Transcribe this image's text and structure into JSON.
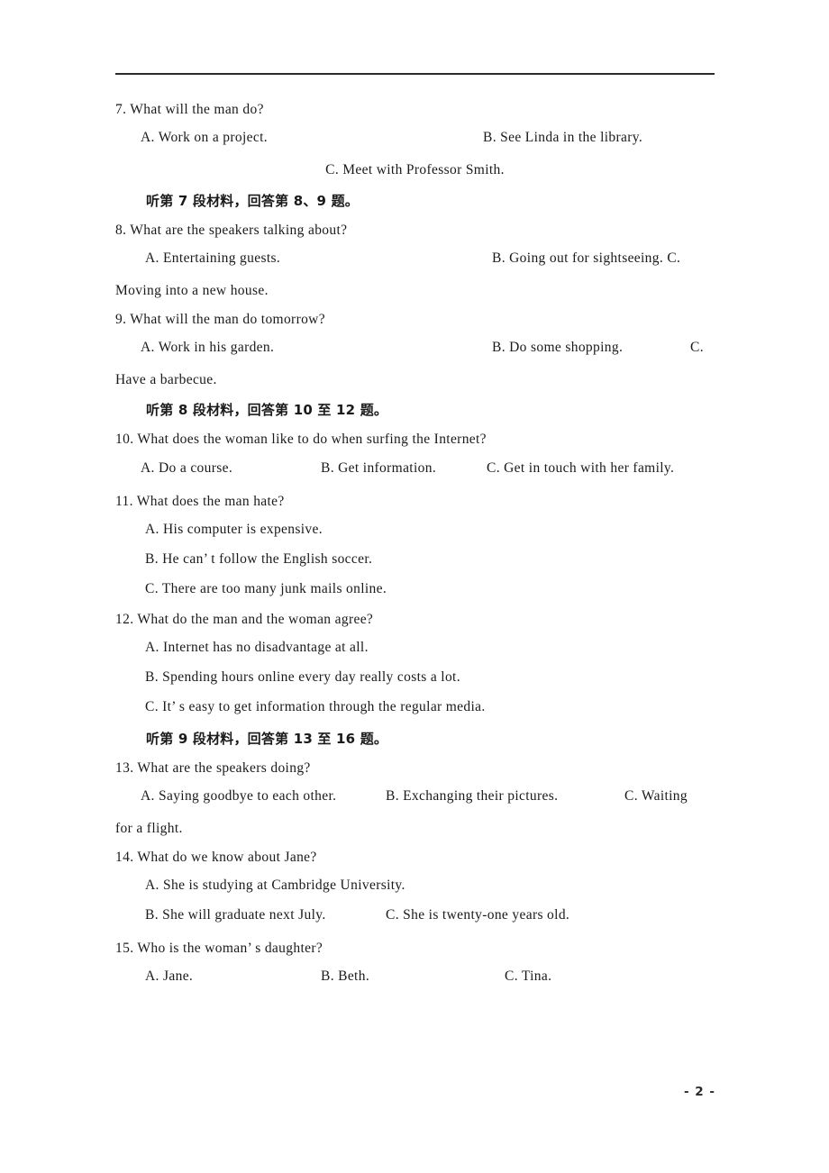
{
  "document": {
    "page_label": "- 2 -",
    "header_rule": true
  },
  "questions": [
    {
      "id": "q7",
      "number": "7.",
      "stem": "7. What will the man do?",
      "options": [
        {
          "letter": "A.",
          "text": "A. Work on a project."
        },
        {
          "letter": "B.",
          "text": "B. See Linda in the library."
        },
        {
          "letter": "C.",
          "text": "C. Meet with Professor Smith."
        }
      ]
    },
    {
      "id": "q8",
      "number": "8.",
      "stem": "8. What are the speakers talking about?",
      "options": [
        {
          "letter": "A.",
          "text": "A. Entertaining guests."
        },
        {
          "letter": "B.",
          "text": "B. Going out for sightseeing. C."
        },
        {
          "letter": "C.",
          "text": "Moving into a new house."
        }
      ]
    },
    {
      "id": "q9",
      "number": "9.",
      "stem": "9.  What will the man do tomorrow?",
      "options": [
        {
          "letter": "A.",
          "text": "A. Work in his garden."
        },
        {
          "letter": "B.",
          "text": "B. Do some shopping."
        },
        {
          "letter": "C.",
          "text": "C."
        },
        {
          "letter": "C-cont",
          "text": "Have a barbecue."
        }
      ]
    },
    {
      "id": "q10",
      "number": "10.",
      "stem": "10. What does the woman like to do when surfing the Internet?",
      "options": [
        {
          "letter": "A.",
          "text": "A. Do a course."
        },
        {
          "letter": "B.",
          "text": "B. Get information."
        },
        {
          "letter": "C.",
          "text": "C. Get in touch with her family."
        }
      ]
    },
    {
      "id": "q11",
      "number": "11.",
      "stem": "11. What does the man hate?",
      "options": [
        {
          "letter": "A.",
          "text": "A. His computer is expensive."
        },
        {
          "letter": "B.",
          "text": "B. He can’ t follow the English soccer."
        },
        {
          "letter": "C.",
          "text": "C. There are too many junk mails online."
        }
      ]
    },
    {
      "id": "q12",
      "number": "12.",
      "stem": "12. What do the man and the woman agree?",
      "options": [
        {
          "letter": "A.",
          "text": "A. Internet has no disadvantage at all."
        },
        {
          "letter": "B.",
          "text": "B. Spending hours online every day really costs a lot."
        },
        {
          "letter": "C.",
          "text": "C. It’ s easy to get information through the regular media."
        }
      ]
    },
    {
      "id": "q13",
      "number": "13.",
      "stem": "13. What are the speakers doing?",
      "options": [
        {
          "letter": "A.",
          "text": "A. Saying goodbye to each other."
        },
        {
          "letter": "B.",
          "text": "B. Exchanging their pictures."
        },
        {
          "letter": "C.",
          "text": "C. Waiting"
        },
        {
          "letter": "C-cont",
          "text": "for a flight."
        }
      ]
    },
    {
      "id": "q14",
      "number": "14.",
      "stem": "14. What do we know about Jane?",
      "options": [
        {
          "letter": "A.",
          "text": "A. She is studying at Cambridge University."
        },
        {
          "letter": "B.",
          "text": "B. She will graduate next July."
        },
        {
          "letter": "C.",
          "text": "C. She is twenty-one years old."
        }
      ]
    },
    {
      "id": "q15",
      "number": "15.",
      "stem": "15. Who is the woman’ s daughter?",
      "options": [
        {
          "letter": "A.",
          "text": "A. Jane."
        },
        {
          "letter": "B.",
          "text": "B. Beth."
        },
        {
          "letter": "C.",
          "text": "C. Tina."
        }
      ]
    }
  ],
  "directions": [
    {
      "id": "d7",
      "text": "听第 7 段材料，回答第 8、9 题。"
    },
    {
      "id": "d8",
      "text": "听第 8 段材料，回答第 10 至 12 题。"
    },
    {
      "id": "d9",
      "text": "听第 9 段材料，回答第 13 至 16 题。"
    }
  ]
}
